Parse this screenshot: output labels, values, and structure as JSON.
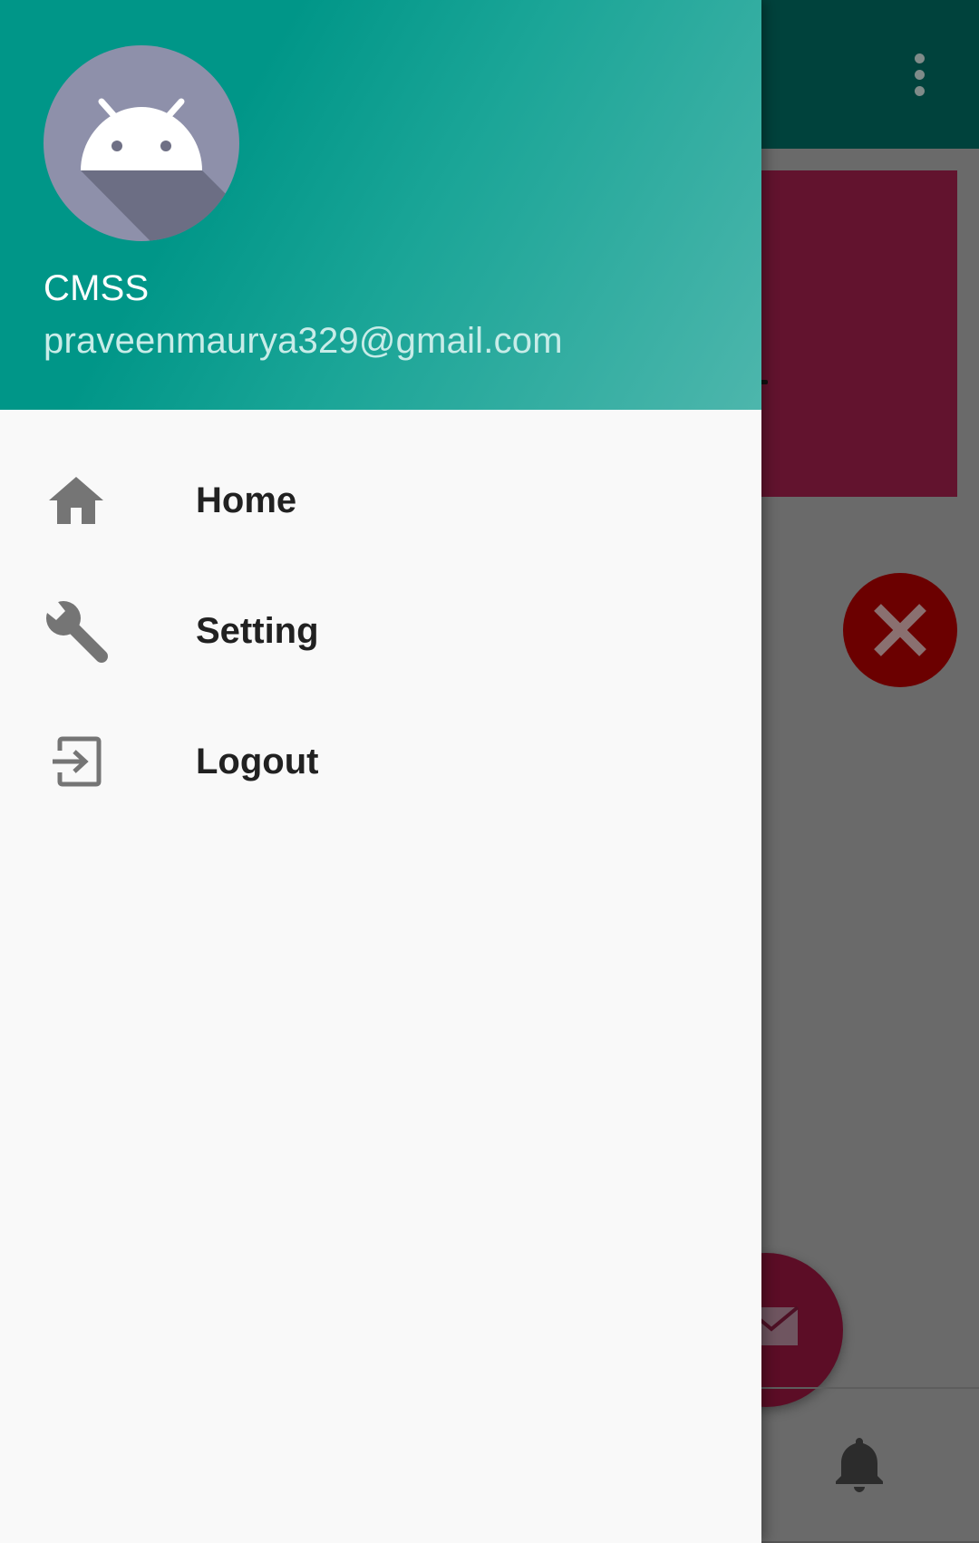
{
  "drawer": {
    "header": {
      "user_name": "CMSS",
      "user_email": "praveenmaurya329@gmail.com",
      "avatar_icon": "android-icon"
    },
    "menu_items": [
      {
        "label": "Home",
        "icon": "home-icon"
      },
      {
        "label": "Setting",
        "icon": "wrench-icon"
      },
      {
        "label": "Logout",
        "icon": "exit-icon"
      }
    ]
  },
  "background": {
    "app_bar_icons": [
      "more-vert-icon"
    ],
    "fab_icons": [
      "close-icon",
      "mail-icon"
    ],
    "bottom_icons": [
      "bell-icon"
    ]
  },
  "colors": {
    "primary": "#009688",
    "header_gradient_end": "#4db6ac",
    "accent": "#880e4f",
    "drawer_background": "#f9f9f9",
    "menu_text": "#212121",
    "menu_icon": "#757575"
  }
}
